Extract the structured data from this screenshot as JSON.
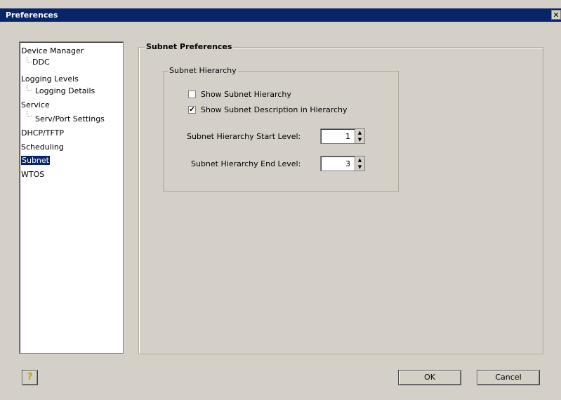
{
  "window": {
    "title": "Preferences",
    "close_glyph": "✕"
  },
  "nav": {
    "items": [
      {
        "label": "Device Manager"
      },
      {
        "label": "DDC"
      },
      {
        "label": "Logging Levels"
      },
      {
        "label": "Logging Details"
      },
      {
        "label": "Service"
      },
      {
        "label": "Serv/Port Settings"
      },
      {
        "label": "DHCP/TFTP"
      },
      {
        "label": "Scheduling"
      },
      {
        "label": "Subnet"
      },
      {
        "label": "WTOS"
      }
    ],
    "selected": "Subnet"
  },
  "subnet_preferences": {
    "title": "Subnet Preferences",
    "hierarchy": {
      "title": "Subnet Hierarchy",
      "show_hierarchy": {
        "label": "Show Subnet Hierarchy",
        "checked": false
      },
      "show_description": {
        "label": "Show Subnet Description in Hierarchy",
        "checked": true,
        "check_glyph": "✔"
      },
      "start_level": {
        "label": "Subnet Hierarchy Start Level:",
        "value": "1"
      },
      "end_level": {
        "label": "Subnet Hierarchy End Level:",
        "value": "3"
      },
      "spin_up": "▲",
      "spin_down": "▼"
    }
  },
  "buttons": {
    "ok": "OK",
    "cancel": "Cancel",
    "help": "?"
  }
}
